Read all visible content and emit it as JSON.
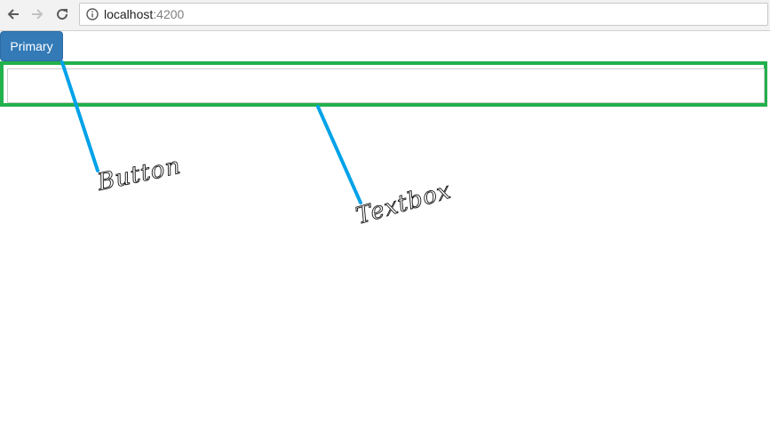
{
  "browser": {
    "url_host": "localhost",
    "url_port": ":4200",
    "back_icon": "arrow-left-icon",
    "forward_icon": "arrow-right-icon",
    "reload_icon": "reload-icon",
    "info_icon": "info-icon"
  },
  "app": {
    "primary_button_label": "Primary",
    "textbox_value": "",
    "textbox_placeholder": ""
  },
  "annotations": {
    "button_label": "Button",
    "textbox_label": "Textbox",
    "line_color": "#00a2e8",
    "highlight_color": "#22b14c"
  },
  "colors": {
    "primary": "#337ab7"
  }
}
